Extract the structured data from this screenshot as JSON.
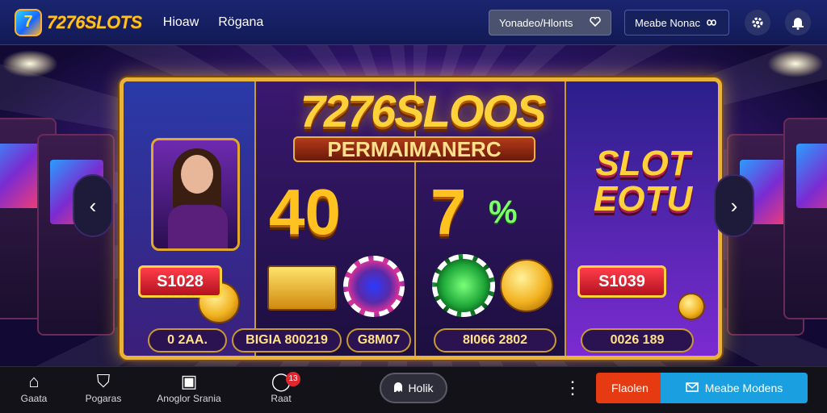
{
  "header": {
    "logo_mark": "7",
    "brand": "7276SLOTS",
    "nav": [
      "Hioaw",
      "Rögana"
    ],
    "lang_button": "Yonadeo/Hlonts",
    "lang_button_icon": "heart-icon",
    "secondary_button": "Meabe Nonac",
    "secondary_icon": "infinity-icon",
    "settings_icon": "gear-icon",
    "profile_icon": "bell-icon"
  },
  "hero": {
    "title": "7276SLOOS",
    "subtitle": "PERMAIMANERC",
    "numbers": [
      "40",
      "7"
    ],
    "percent": "%",
    "right_badge": "SLOT\nEOTU",
    "tag_left": "S1028",
    "tag_right": "S1039",
    "pills": [
      "0 2AA.",
      "BIGIA 800219",
      "G8M07",
      "8I066 2802",
      "0026 189"
    ],
    "left_arrow": "‹",
    "right_arrow": "›"
  },
  "bottom_nav": {
    "items": [
      {
        "label": "Gaata",
        "icon": "home-icon",
        "glyph": "⌂"
      },
      {
        "label": "Pogaras",
        "icon": "shield-icon",
        "glyph": "⛉"
      },
      {
        "label": "Anoglor Srania",
        "icon": "gift-icon",
        "glyph": "▣"
      },
      {
        "label": "Raat",
        "icon": "chat-icon",
        "glyph": "◯",
        "badge": "13"
      }
    ],
    "hold_label": "Holik",
    "hold_icon": "ghost-icon",
    "more_icon": "more-vertical-icon",
    "cta_primary": "Flaolen",
    "cta_secondary": "Meabe Modens",
    "cta_secondary_icon": "mail-icon"
  },
  "colors": {
    "topbar": "#1a2570",
    "accent_gold": "#ffc21f",
    "cta_red": "#e53a12",
    "cta_blue": "#1a9fe0",
    "badge_red": "#e0262e"
  }
}
